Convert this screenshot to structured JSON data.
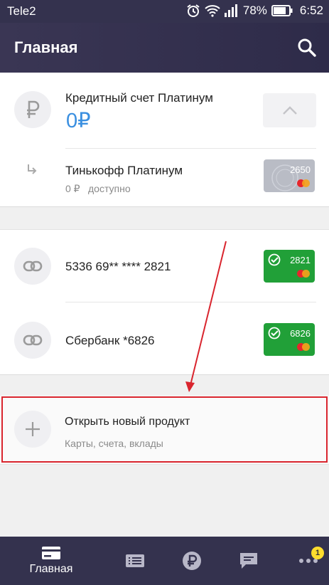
{
  "status_bar": {
    "carrier": "Tele2",
    "battery": "78%",
    "time": "6:52"
  },
  "header": {
    "title": "Главная"
  },
  "credit_account": {
    "title": "Кредитный счет Платинум",
    "amount": "0",
    "currency": "₽",
    "sub_title": "Тинькофф Платинум",
    "available_amount": "0 ₽",
    "available_label": "доступно",
    "card_last4": "2650"
  },
  "linked_cards": [
    {
      "title": "5336 69** **** 2821",
      "card_last4": "2821"
    },
    {
      "title": "Сбербанк *6826",
      "card_last4": "6826"
    }
  ],
  "new_product": {
    "title": "Открыть новый продукт",
    "subtitle": "Карты, счета, вклады"
  },
  "bottom_nav": {
    "home_label": "Главная",
    "badge_count": "1"
  },
  "colors": {
    "header_bg": "#34324e",
    "accent_blue": "#3a8fe0",
    "sber_green": "#21a038",
    "highlight_red": "#d9252e",
    "badge_yellow": "#ffdd2d"
  }
}
